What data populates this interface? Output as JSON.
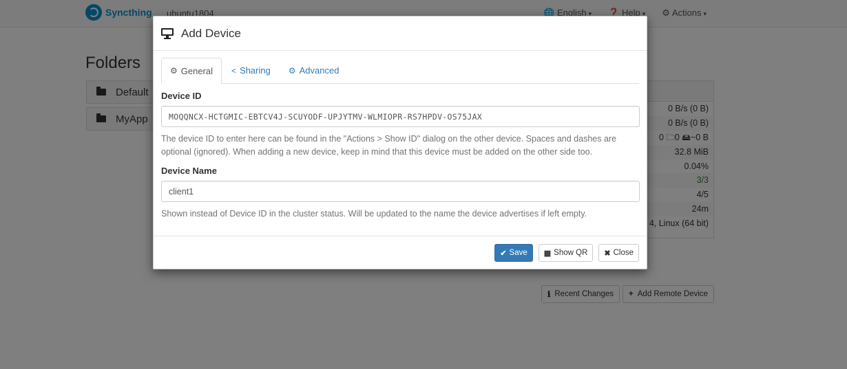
{
  "navbar": {
    "brand": "Syncthing",
    "hostname": "ubuntu1804",
    "language": "English",
    "help": "Help",
    "actions": "Actions"
  },
  "folders": {
    "title": "Folders",
    "items": [
      {
        "label": "Default"
      },
      {
        "label": "MyApp"
      }
    ]
  },
  "device_panel": {
    "rows": [
      "0 B/s (0 B)",
      "0 B/s (0 B)",
      "0  🗀0  🖴~0 B",
      "32.8 MiB",
      "0.04%",
      "3/3",
      "4/5",
      "24m",
      "4, Linux (64 bit)"
    ]
  },
  "bottom_buttons": {
    "recent_changes": "Recent Changes",
    "add_remote_device": "Add Remote Device"
  },
  "modal": {
    "title": "Add Device",
    "tabs": [
      {
        "label": "General",
        "icon": "gear-icon",
        "active": true
      },
      {
        "label": "Sharing",
        "icon": "share-icon",
        "active": false
      },
      {
        "label": "Advanced",
        "icon": "cogs-icon",
        "active": false
      }
    ],
    "device_id": {
      "label": "Device ID",
      "value": "MOQQNCX-HCTGMIC-EBTCV4J-SCUYODF-UPJYTMV-WLMIOPR-RS7HPDV-OS75JAX",
      "help": "The device ID to enter here can be found in the \"Actions > Show ID\" dialog on the other device. Spaces and dashes are optional (ignored). When adding a new device, keep in mind that this device must be added on the other side too."
    },
    "device_name": {
      "label": "Device Name",
      "value": "client1",
      "help": "Shown instead of Device ID in the cluster status. Will be updated to the name the device advertises if left empty."
    },
    "buttons": {
      "save": "Save",
      "show_qr": "Show QR",
      "close": "Close"
    }
  },
  "colors": {
    "primary": "#337ab7",
    "brand": "#0891d1",
    "link": "#337ab7"
  }
}
